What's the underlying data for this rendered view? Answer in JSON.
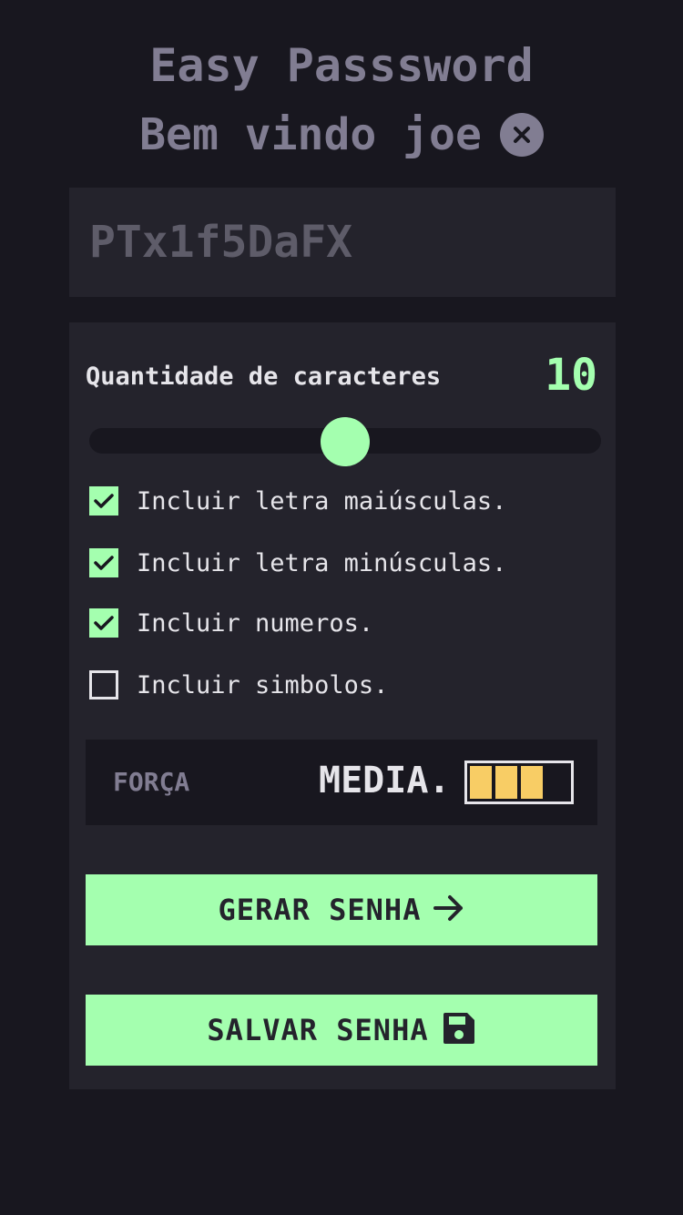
{
  "header": {
    "app_title": "Easy Passsword",
    "welcome": "Bem vindo joe",
    "close_icon": "close-circle-icon"
  },
  "password": {
    "value": "PTx1f5DaFX"
  },
  "length": {
    "label": "Quantidade de caracteres",
    "value": "10",
    "slider_fraction": 0.5
  },
  "options": [
    {
      "label": "Incluir letra maiúsculas.",
      "checked": true
    },
    {
      "label": "Incluir letra minúsculas.",
      "checked": true
    },
    {
      "label": "Incluir numeros.",
      "checked": true
    },
    {
      "label": "Incluir simbolos.",
      "checked": false
    }
  ],
  "strength": {
    "label": "FORÇA",
    "value": "MEDIA.",
    "level": 3,
    "max_level": 4
  },
  "buttons": {
    "generate_label": "GERAR SENHA",
    "generate_icon": "arrow-right-icon",
    "save_label": "SALVAR SENHA",
    "save_icon": "floppy-disk-icon"
  },
  "colors": {
    "background": "#18171f",
    "panel": "#24232c",
    "accent": "#a4ffaf",
    "strength_medium": "#f8cd65",
    "muted": "#817d92"
  }
}
